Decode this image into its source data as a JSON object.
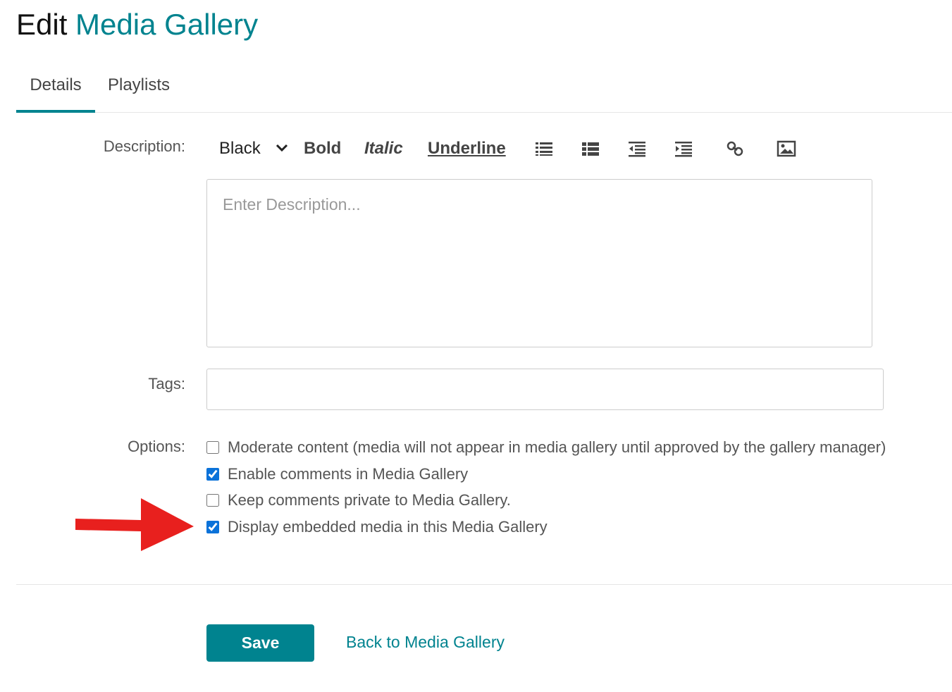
{
  "header": {
    "title_prefix": "Edit",
    "title_accent": "Media Gallery"
  },
  "tabs": [
    {
      "label": "Details",
      "active": true
    },
    {
      "label": "Playlists",
      "active": false
    }
  ],
  "description": {
    "label": "Description:",
    "toolbar": {
      "color_value": "Black",
      "bold_label": "Bold",
      "italic_label": "Italic",
      "underline_label": "Underline",
      "icons": [
        "bulleted-list-icon",
        "numbered-list-icon",
        "outdent-icon",
        "indent-icon",
        "link-icon",
        "image-icon"
      ]
    },
    "placeholder": "Enter Description...",
    "value": ""
  },
  "tags": {
    "label": "Tags:",
    "value": ""
  },
  "options": {
    "label": "Options:",
    "items": [
      {
        "label": "Moderate content (media will not appear in media gallery until approved by the gallery manager)",
        "checked": false
      },
      {
        "label": "Enable comments in Media Gallery",
        "checked": true
      },
      {
        "label": "Keep comments private to Media Gallery.",
        "checked": false
      },
      {
        "label": "Display embedded media in this Media Gallery",
        "checked": true
      }
    ]
  },
  "actions": {
    "save_label": "Save",
    "back_label": "Back to Media Gallery"
  },
  "colors": {
    "accent": "#00838f",
    "annotation_arrow": "#e8201e",
    "checkbox": "#0b72d9"
  }
}
